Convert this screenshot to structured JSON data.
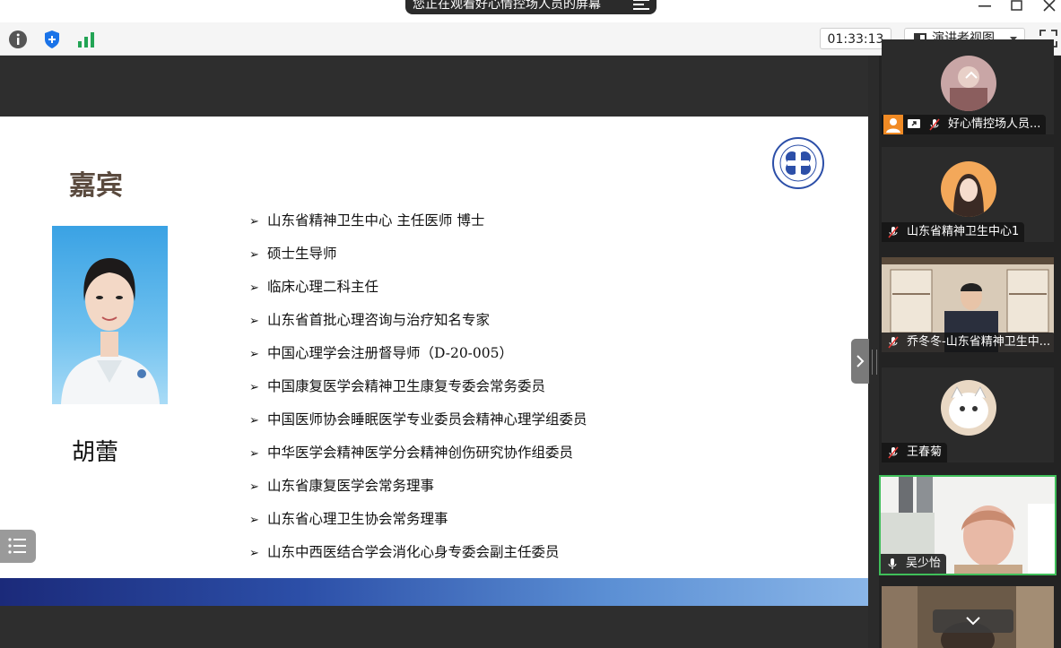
{
  "window": {
    "share_banner": "您正在观看好心情控场人员的屏幕",
    "minimize_icon": "minimize-icon",
    "maximize_icon": "maximize-icon",
    "close_icon": "close-icon"
  },
  "toolbar": {
    "info_icon": "info-icon",
    "security_icon": "shield-icon",
    "signal_icon": "signal-bars-icon",
    "timer": "01:33:13",
    "view_mode": "演讲者视图",
    "fullscreen_icon": "fullscreen-icon",
    "accent_green": "#23a455",
    "accent_blue": "#1a73e8"
  },
  "slide": {
    "heading": "嘉宾",
    "speaker_name": "胡蕾",
    "bullets": [
      "山东省精神卫生中心  主任医师  博士",
      "硕士生导师",
      "临床心理二科主任",
      "山东省首批心理咨询与治疗知名专家",
      "中国心理学会注册督导师（D-20-005）",
      "中国康复医学会精神卫生康复专委会常务委员",
      "中国医师协会睡眠医学专业委员会精神心理学组委员",
      "中华医学会精神医学分会精神创伤研究协作组委员",
      "山东省康复医学会常务理事",
      "山东省心理卫生协会常务理事",
      "山东中西医结合学会消化心身专委会副主任委员"
    ],
    "bullet_glyph": "➢",
    "logo_icon": "hospital-logo-icon"
  },
  "participants": [
    {
      "name": "好心情控场人员...",
      "mic": "mic-muted-icon",
      "active": false
    },
    {
      "name": "山东省精神卫生中心1",
      "mic": "mic-muted-icon",
      "active": false
    },
    {
      "name": "乔冬冬-山东省精神卫生中...",
      "mic": "mic-muted-icon",
      "active": false
    },
    {
      "name": "王春菊",
      "mic": "mic-muted-icon",
      "active": false
    },
    {
      "name": "吴少怡",
      "mic": "mic-icon",
      "active": true
    }
  ],
  "active_speaker_color": "#3fbf5a"
}
